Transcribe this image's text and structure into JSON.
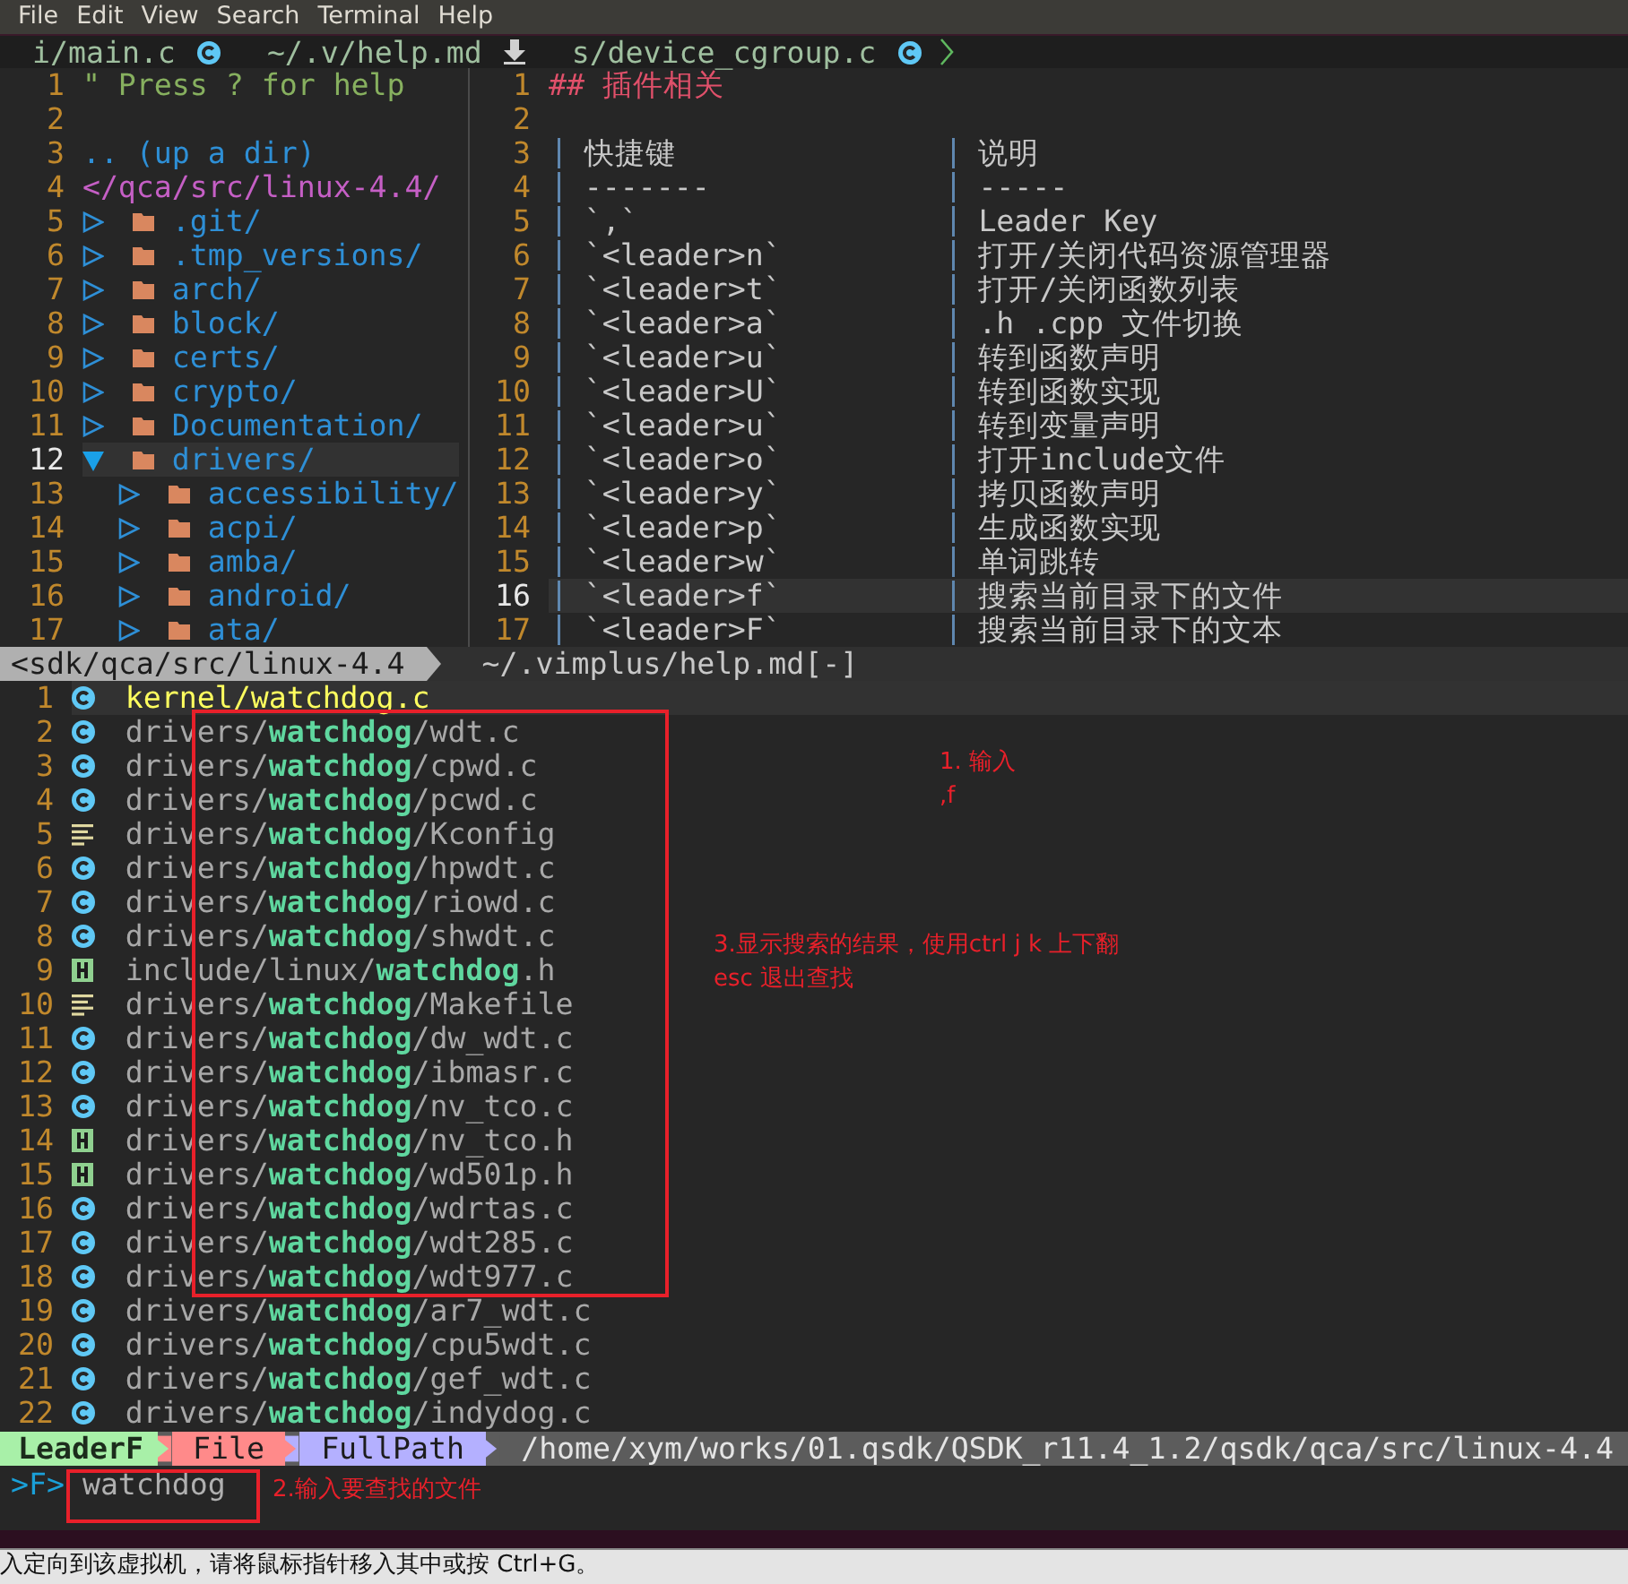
{
  "menu_bar": [
    "File",
    "Edit",
    "View",
    "Search",
    "Terminal",
    "Help"
  ],
  "tabline": {
    "tabs": [
      {
        "label": "i/main.c",
        "kind": "c"
      },
      {
        "label": "~/.v/help.md",
        "kind": "download"
      },
      {
        "label": "s/device_cgroup.c",
        "kind": "c"
      }
    ]
  },
  "file_tree": {
    "header": [
      {
        "num": "1",
        "kind": "help",
        "text": "\" Press ? for help"
      },
      {
        "num": "2",
        "kind": "blank"
      },
      {
        "num": "3",
        "kind": "updir",
        "text": ".. (up a dir)"
      },
      {
        "num": "4",
        "kind": "root",
        "text": "</qca/src/linux-4.4/"
      }
    ],
    "items": [
      {
        "num": "5",
        "name": ".git/",
        "expanded": false,
        "selected": false
      },
      {
        "num": "6",
        "name": ".tmp_versions/",
        "expanded": false,
        "selected": false
      },
      {
        "num": "7",
        "name": "arch/",
        "expanded": false,
        "selected": false
      },
      {
        "num": "8",
        "name": "block/",
        "expanded": false,
        "selected": false
      },
      {
        "num": "9",
        "name": "certs/",
        "expanded": false,
        "selected": false
      },
      {
        "num": "10",
        "name": "crypto/",
        "expanded": false,
        "selected": false
      },
      {
        "num": "11",
        "name": "Documentation/",
        "expanded": false,
        "selected": false
      },
      {
        "num": "12",
        "name": "drivers/",
        "expanded": true,
        "selected": true,
        "children": [
          {
            "num": "13",
            "name": "accessibility/",
            "expanded": false,
            "selected": false
          },
          {
            "num": "14",
            "name": "acpi/",
            "expanded": false,
            "selected": false
          },
          {
            "num": "15",
            "name": "amba/",
            "expanded": false,
            "selected": false
          },
          {
            "num": "16",
            "name": "android/",
            "expanded": false,
            "selected": false
          },
          {
            "num": "17",
            "name": "ata/",
            "expanded": false,
            "selected": false
          }
        ]
      }
    ]
  },
  "markdown": {
    "lines": [
      {
        "num": "1",
        "kind": "heading",
        "text": "## 插件相关",
        "selected": false
      },
      {
        "num": "2",
        "kind": "blank",
        "selected": false
      },
      {
        "num": "3",
        "kind": "row",
        "cells": [
          "快捷键",
          "说明"
        ],
        "selected": false
      },
      {
        "num": "4",
        "kind": "row",
        "cells": [
          "-------",
          "-----"
        ],
        "selected": false
      },
      {
        "num": "5",
        "kind": "row",
        "cells": [
          "`,`",
          "Leader Key"
        ],
        "selected": false
      },
      {
        "num": "6",
        "kind": "row",
        "cells": [
          "`<leader>n`",
          "打开/关闭代码资源管理器"
        ],
        "selected": false
      },
      {
        "num": "7",
        "kind": "row",
        "cells": [
          "`<leader>t`",
          "打开/关闭函数列表"
        ],
        "selected": false
      },
      {
        "num": "8",
        "kind": "row",
        "cells": [
          "`<leader>a`",
          ".h .cpp 文件切换"
        ],
        "selected": false
      },
      {
        "num": "9",
        "kind": "row",
        "cells": [
          "`<leader>u`",
          "转到函数声明"
        ],
        "selected": false
      },
      {
        "num": "10",
        "kind": "row",
        "cells": [
          "`<leader>U`",
          "转到函数实现"
        ],
        "selected": false
      },
      {
        "num": "11",
        "kind": "row",
        "cells": [
          "`<leader>u`",
          "转到变量声明"
        ],
        "selected": false
      },
      {
        "num": "12",
        "kind": "row",
        "cells": [
          "`<leader>o`",
          "打开include文件"
        ],
        "selected": false
      },
      {
        "num": "13",
        "kind": "row",
        "cells": [
          "`<leader>y`",
          "拷贝函数声明"
        ],
        "selected": false
      },
      {
        "num": "14",
        "kind": "row",
        "cells": [
          "`<leader>p`",
          "生成函数实现"
        ],
        "selected": false
      },
      {
        "num": "15",
        "kind": "row",
        "cells": [
          "`<leader>w`",
          "单词跳转"
        ],
        "selected": false
      },
      {
        "num": "16",
        "kind": "row",
        "cells": [
          "`<leader>f`",
          "搜索当前目录下的文件"
        ],
        "selected": true
      },
      {
        "num": "17",
        "kind": "row",
        "cells": [
          "`<leader>F`",
          "搜索当前目录下的文本"
        ],
        "selected": false
      }
    ]
  },
  "status_lines": {
    "left": "<sdk/qca/src/linux-4.4",
    "right": "~/.vimplus/help.md[-]"
  },
  "results": [
    {
      "num": "1",
      "kind": "c",
      "path": "kernel/**watchdog**.c",
      "selected": true
    },
    {
      "num": "2",
      "kind": "c",
      "path": "drivers/**watchdog**/wdt.c",
      "selected": false
    },
    {
      "num": "3",
      "kind": "c",
      "path": "drivers/**watchdog**/cpwd.c",
      "selected": false
    },
    {
      "num": "4",
      "kind": "c",
      "path": "drivers/**watchdog**/pcwd.c",
      "selected": false
    },
    {
      "num": "5",
      "kind": "text",
      "path": "drivers/**watchdog**/Kconfig",
      "selected": false
    },
    {
      "num": "6",
      "kind": "c",
      "path": "drivers/**watchdog**/hpwdt.c",
      "selected": false
    },
    {
      "num": "7",
      "kind": "c",
      "path": "drivers/**watchdog**/riowd.c",
      "selected": false
    },
    {
      "num": "8",
      "kind": "c",
      "path": "drivers/**watchdog**/shwdt.c",
      "selected": false
    },
    {
      "num": "9",
      "kind": "h",
      "path": "include/linux/**watchdog**.h",
      "selected": false
    },
    {
      "num": "10",
      "kind": "text",
      "path": "drivers/**watchdog**/Makefile",
      "selected": false
    },
    {
      "num": "11",
      "kind": "c",
      "path": "drivers/**watchdog**/dw_wdt.c",
      "selected": false
    },
    {
      "num": "12",
      "kind": "c",
      "path": "drivers/**watchdog**/ibmasr.c",
      "selected": false
    },
    {
      "num": "13",
      "kind": "c",
      "path": "drivers/**watchdog**/nv_tco.c",
      "selected": false
    },
    {
      "num": "14",
      "kind": "h",
      "path": "drivers/**watchdog**/nv_tco.h",
      "selected": false
    },
    {
      "num": "15",
      "kind": "h",
      "path": "drivers/**watchdog**/wd501p.h",
      "selected": false
    },
    {
      "num": "16",
      "kind": "c",
      "path": "drivers/**watchdog**/wdrtas.c",
      "selected": false
    },
    {
      "num": "17",
      "kind": "c",
      "path": "drivers/**watchdog**/wdt285.c",
      "selected": false
    },
    {
      "num": "18",
      "kind": "c",
      "path": "drivers/**watchdog**/wdt977.c",
      "selected": false
    },
    {
      "num": "19",
      "kind": "c",
      "path": "drivers/**watchdog**/ar7_wdt.c",
      "selected": false
    },
    {
      "num": "20",
      "kind": "c",
      "path": "drivers/**watchdog**/cpu5wdt.c",
      "selected": false
    },
    {
      "num": "21",
      "kind": "c",
      "path": "drivers/**watchdog**/gef_wdt.c",
      "selected": false
    },
    {
      "num": "22",
      "kind": "c",
      "path": "drivers/**watchdog**/indydog.c",
      "selected": false
    }
  ],
  "leaderf_bar": {
    "mode": "LeaderF",
    "category": "File",
    "match_mode": "FullPath",
    "cwd": "/home/xym/works/01.qsdk/QSDK_r11.4_1.2/qsdk/qca/src/linux-4.4"
  },
  "prompt": {
    "symbol": ">F>",
    "value": "watchdog"
  },
  "annotations": [
    {
      "kind": "box"
    },
    {
      "kind": "note",
      "lines": [
        "1. 输入",
        ",f"
      ]
    },
    {
      "kind": "note",
      "lines": [
        "3.显示搜索的结果，使用ctrl j k 上下翻",
        "esc 退出查找"
      ]
    },
    {
      "kind": "box"
    },
    {
      "kind": "note",
      "lines": [
        "2.输入要查找的文件"
      ]
    }
  ],
  "host_message": "入定向到该虚拟机，请将鼠标指针移入其中或按 Ctrl+G。"
}
